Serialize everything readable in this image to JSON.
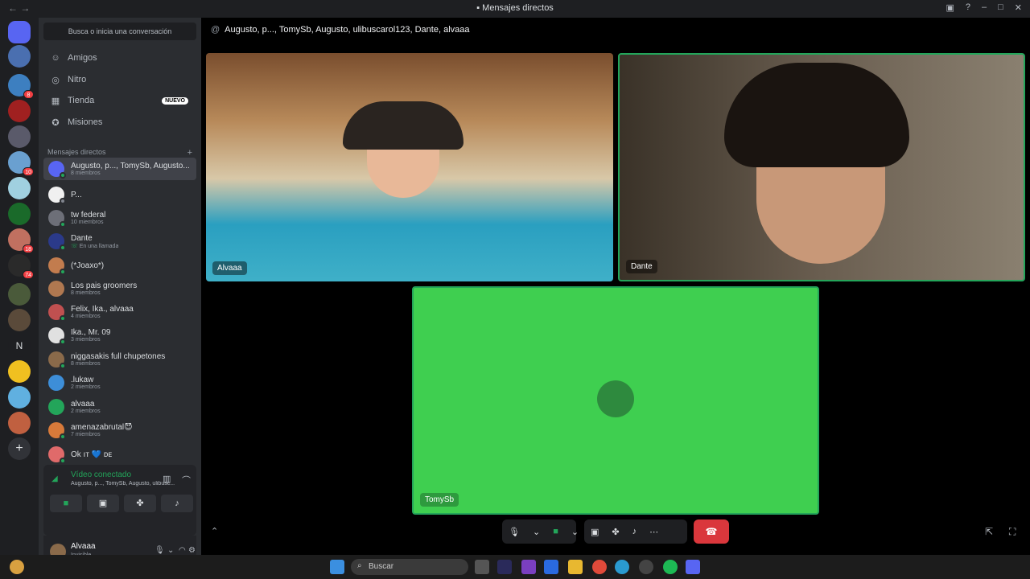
{
  "window": {
    "title": "Mensajes directos"
  },
  "search": {
    "placeholder": "Busca o inicia una conversación"
  },
  "nav": [
    {
      "label": "Amigos",
      "icon": "friends-icon"
    },
    {
      "label": "Nitro",
      "icon": "nitro-icon"
    },
    {
      "label": "Tienda",
      "icon": "shop-icon",
      "badge": "NUEVO"
    },
    {
      "label": "Misiones",
      "icon": "quests-icon"
    }
  ],
  "dm_header": "Mensajes directos",
  "dms": [
    {
      "name": "Augusto, p..., TomySb, Augusto...",
      "sub": "8 miembros",
      "color": "#5865f2"
    },
    {
      "name": "P...",
      "sub": "",
      "color": "#ffffff"
    },
    {
      "name": "tw federal",
      "sub": "10 miembros",
      "color": "#6d6f78"
    },
    {
      "name": "Dante",
      "sub": "En una llamada",
      "color": "#2b3a8a"
    },
    {
      "name": "(*Joaxo*)",
      "sub": "",
      "color": "#c27c4e"
    },
    {
      "name": "Los pais groomers",
      "sub": "8 miembros",
      "color": "#b07850"
    },
    {
      "name": "Felix, Ika., alvaaa",
      "sub": "4 miembros",
      "color": "#c05050"
    },
    {
      "name": "Ika., Mr. 09",
      "sub": "3 miembros",
      "color": "#e0e0e0"
    },
    {
      "name": "niggasakis full chupetones",
      "sub": "8 miembros",
      "color": "#8a6a4a"
    },
    {
      "name": ".lukaw",
      "sub": "2 miembros",
      "color": "#3d8ed8"
    },
    {
      "name": "alvaaa",
      "sub": "2 miembros",
      "color": "#23a55a"
    },
    {
      "name": "amenazabrutal😈",
      "sub": "7 miembros",
      "color": "#d87a3a"
    },
    {
      "name": "Ok ıт 💙 ᴅᴇ",
      "sub": "",
      "color": "#e06a6a"
    }
  ],
  "voice": {
    "status": "Vídeo conectado",
    "channel": "Augusto, p..., TomySb, Augusto, ulibusc..."
  },
  "user": {
    "name": "Alvaaa",
    "status": "Invisible"
  },
  "channel_header": "Augusto, p..., TomySb, Augusto, ulibuscarol123, Dante, alvaaa",
  "tiles": [
    {
      "label": "Alvaaa"
    },
    {
      "label": "Dante"
    },
    {
      "label": "TomySb"
    }
  ],
  "server_badges": [
    "8",
    "10",
    "18",
    "74"
  ],
  "server_letter": "N",
  "taskbar": {
    "search": "Buscar"
  }
}
